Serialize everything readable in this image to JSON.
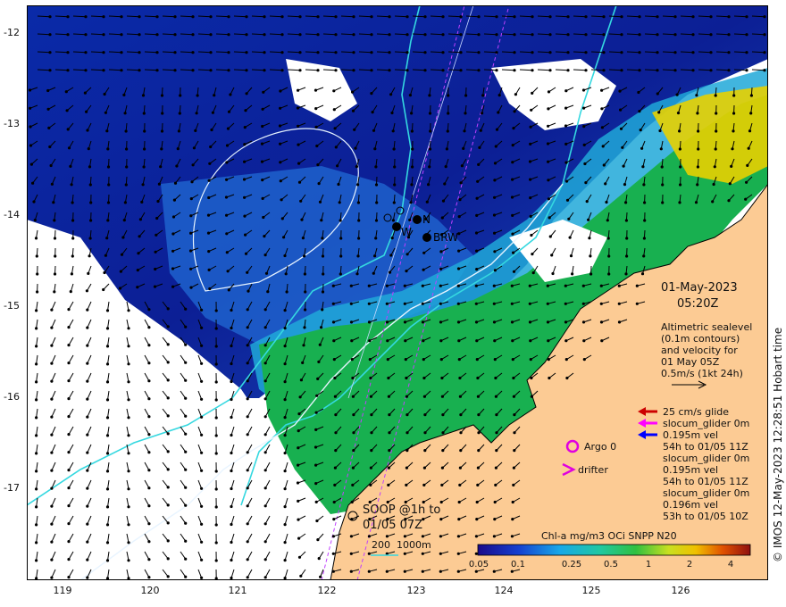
{
  "title": {
    "date": "01-May-2023",
    "time": "05:20Z"
  },
  "altimetry_note": [
    "Altimetric sealevel",
    "(0.1m contours)",
    "and velocity for",
    "01 May 05Z",
    "0.5m/s (1kt 24h)"
  ],
  "credit": "© IMOS 12-May-2023 12:28:51 Hobart time",
  "y_axis": {
    "ticks": [
      "-12",
      "-13",
      "-14",
      "-15",
      "-16",
      "-17"
    ]
  },
  "x_axis": {
    "ticks": [
      "119",
      "120",
      "121",
      "122",
      "123",
      "124",
      "125",
      "126"
    ]
  },
  "colorbar": {
    "title": "Chl-a mg/m3 OCi SNPP N20",
    "ticks": [
      "0.05",
      "0.1",
      "0.25",
      "0.5",
      "1",
      "2",
      "4"
    ]
  },
  "legend": {
    "glide": "25 cm/s glide",
    "entries": [
      {
        "color": "#ff00ff",
        "lines": [
          "slocum_glider 0m",
          "0.195m vel",
          "54h to 01/05 11Z"
        ]
      },
      {
        "color": "#0000ff",
        "lines": [
          "slocum_glider 0m",
          "0.195m vel",
          "54h to 01/05 11Z"
        ]
      },
      {
        "color": "#cc0000",
        "lines": [
          "slocum_glider 0m",
          "0.196m vel",
          "53h to 01/05 10Z"
        ]
      }
    ],
    "argo": "Argo 0",
    "drifter": "drifter"
  },
  "soop": [
    "SOOP @1h to",
    "01/05 07Z"
  ],
  "depth_legend": "200  1000m",
  "moorings": [
    {
      "label": "W"
    },
    {
      "label": "N"
    },
    {
      "label": "BRW"
    }
  ],
  "colors": {
    "land": "#fccb94",
    "deep": "#0a1d9c",
    "mid": "#1f6fd8",
    "shelf": "#18b050",
    "high": "#e8d000",
    "contour_200": "#35d8e0",
    "contour_1000": "#e8f4ff"
  }
}
